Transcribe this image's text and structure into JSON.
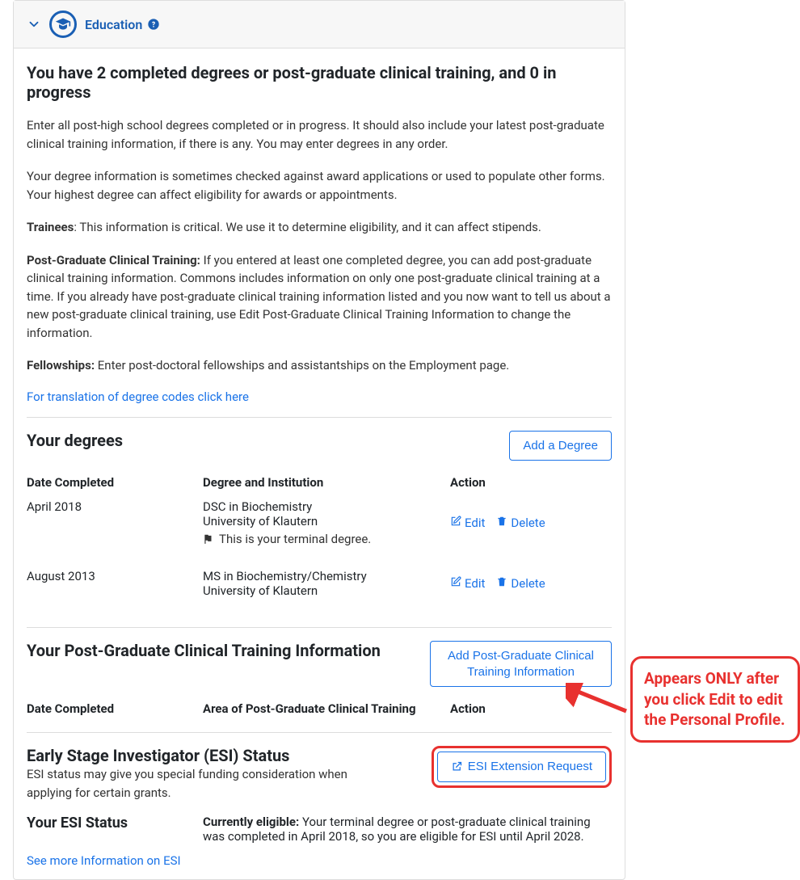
{
  "header": {
    "title": "Education"
  },
  "summary_heading": "You have 2 completed degrees or post-graduate clinical training, and 0 in progress",
  "paragraphs": {
    "p1": "Enter all post-high school degrees completed or in progress. It should also include your latest post-graduate clinical training information, if there is any. You may enter degrees in any order.",
    "p2": "Your degree information is sometimes checked against award applications or used to populate other forms. Your highest degree can affect eligibility for awards or appointments.",
    "trainees_label": "Trainees",
    "trainees_text": ": This information is critical. We use it to determine eligibility, and it can affect stipends.",
    "pgct_label": "Post-Graduate Clinical Training:",
    "pgct_text": " If you entered at least one completed degree, you can add post-graduate clinical training information. Commons includes information on only one post-graduate clinical training at a time. If you already have post-graduate clinical training information listed and you now want to tell us about a new post-graduate clinical training, use Edit Post-Graduate Clinical Training Information to change the information.",
    "fellowships_label": "Fellowships:",
    "fellowships_text": " Enter post-doctoral fellowships and assistantships on the Employment page.",
    "code_link": "For translation of degree codes click here"
  },
  "degrees": {
    "section_title": "Your degrees",
    "add_button": "Add a Degree",
    "headers": {
      "date": "Date Completed",
      "degree": "Degree and Institution",
      "action": "Action"
    },
    "rows": [
      {
        "date": "April 2018",
        "degree_line": "DSC in Biochemistry",
        "institution": "University of Klautern",
        "terminal_note": "This is your terminal degree."
      },
      {
        "date": "August 2013",
        "degree_line": "MS in Biochemistry/Chemistry",
        "institution": "University of Klautern",
        "terminal_note": ""
      }
    ],
    "edit_label": "Edit",
    "delete_label": "Delete"
  },
  "pgct": {
    "section_title": "Your Post-Graduate Clinical Training Information",
    "add_button": "Add Post-Graduate Clinical Training Information",
    "headers": {
      "date": "Date Completed",
      "area": "Area of Post-Graduate Clinical Training",
      "action": "Action"
    }
  },
  "esi": {
    "section_title": "Early Stage Investigator (ESI) Status",
    "desc": "ESI status may give you special funding consideration when applying for certain grants.",
    "request_button": "ESI Extension Request",
    "status_title": "Your ESI Status",
    "eligible_label": "Currently eligible:",
    "eligible_text": " Your terminal degree or post-graduate clinical training was completed in April 2018, so you are eligible for ESI until April 2028.",
    "more_link": "See more Information on ESI"
  },
  "callout": "Appears ONLY after you click Edit to edit the Personal Profile."
}
